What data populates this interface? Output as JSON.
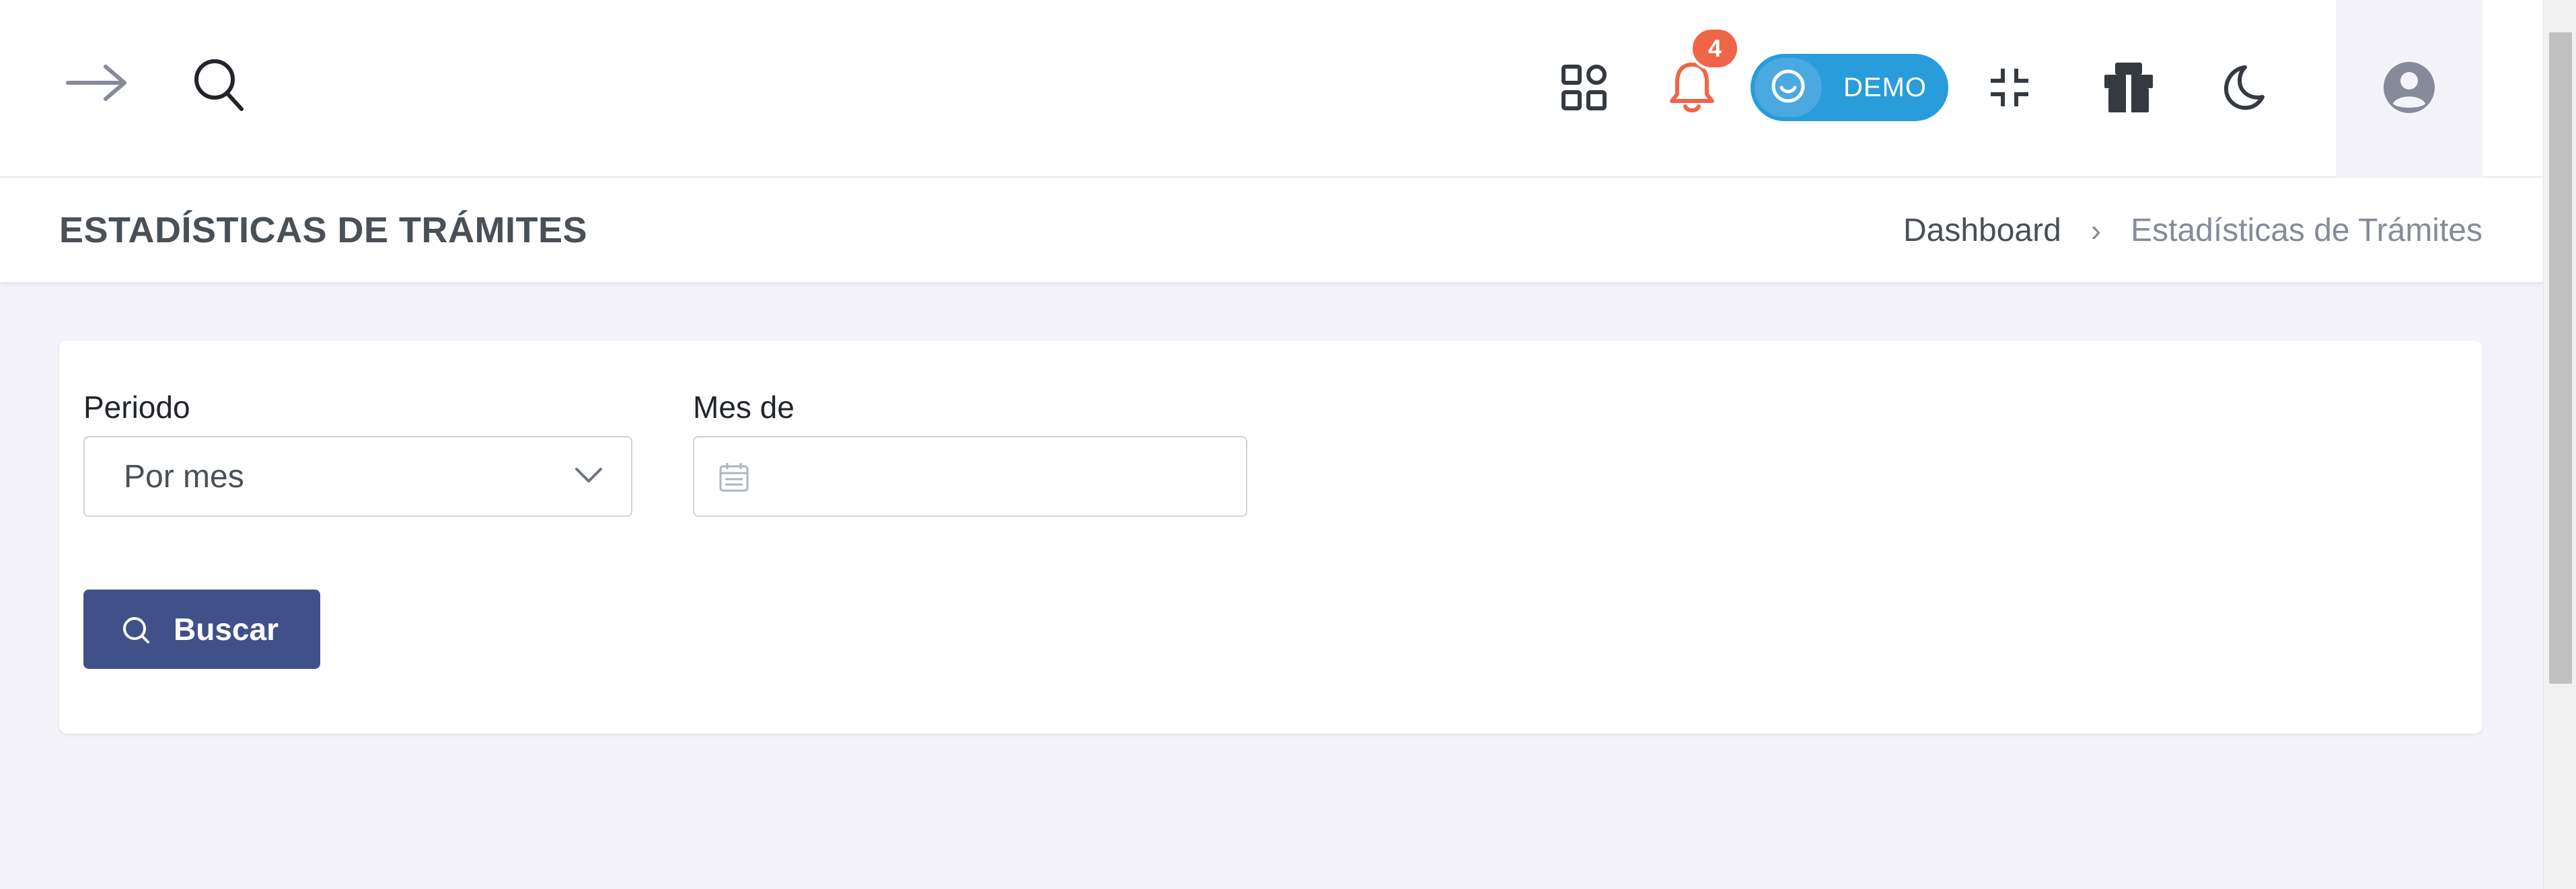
{
  "header": {
    "notification_count": "4",
    "demo_toggle_label": "DEMO",
    "icons": {
      "toggle_sidebar": "arrow-right-icon",
      "search": "search-icon",
      "apps": "apps-grid-icon",
      "notifications": "bell-icon",
      "fullscreen": "shrink-icon",
      "gift": "gift-icon",
      "theme": "moon-icon",
      "user": "user-circle-icon"
    }
  },
  "page": {
    "title": "ESTADÍSTICAS DE TRÁMITES",
    "breadcrumb": {
      "home": "Dashboard",
      "separator": "›",
      "current": "Estadísticas de Trámites"
    }
  },
  "form": {
    "period_label": "Periodo",
    "period_value": "Por mes",
    "month_label": "Mes de",
    "month_value": "",
    "search_button_label": "Buscar"
  },
  "colors": {
    "primary": "#405189",
    "notification_badge": "#ef6547",
    "demo_pill": "#299cdb",
    "page_background": "#f3f3f9"
  }
}
